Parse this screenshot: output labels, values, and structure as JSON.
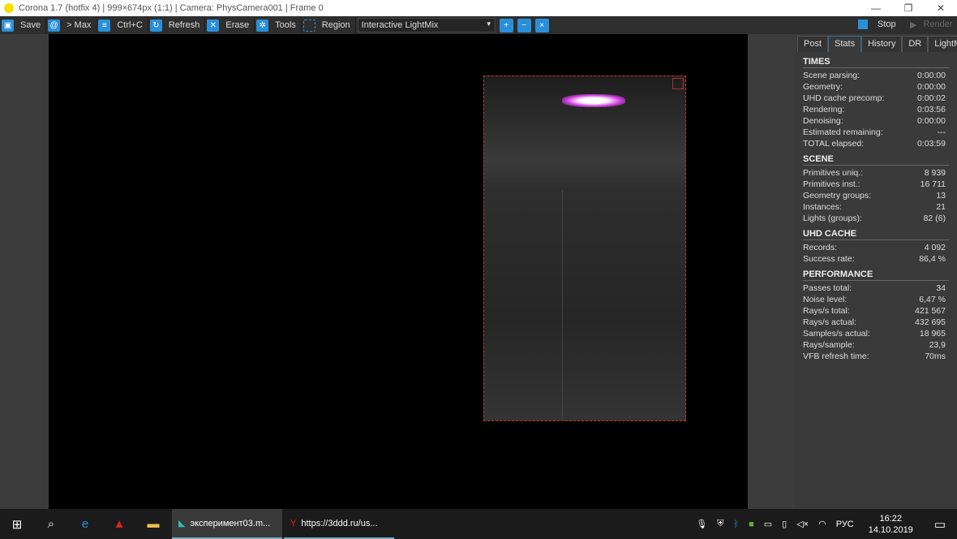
{
  "window": {
    "title": "Corona 1.7 (hotfix 4) | 999×674px (1:1) | Camera: PhysCamera001 | Frame 0",
    "minimize": "—",
    "restore": "❐",
    "close": "✕"
  },
  "toolbar": {
    "save": "Save",
    "max": "> Max",
    "copy": "Ctrl+C",
    "refresh": "Refresh",
    "erase": "Erase",
    "tools": "Tools",
    "region": "Region",
    "mode": "Interactive LightMix",
    "stop": "Stop",
    "render": "Render"
  },
  "tabs": [
    "Post",
    "Stats",
    "History",
    "DR",
    "LightMix"
  ],
  "stats": {
    "times": {
      "title": "TIMES",
      "rows": [
        [
          "Scene parsing:",
          "0:00:00"
        ],
        [
          "Geometry:",
          "0:00:00"
        ],
        [
          "UHD cache precomp:",
          "0:00:02"
        ],
        [
          "Rendering:",
          "0:03:56"
        ],
        [
          "Denoising:",
          "0:00:00"
        ],
        [
          "Estimated remaining:",
          "---"
        ],
        [
          "TOTAL elapsed:",
          "0:03:59"
        ]
      ]
    },
    "scene": {
      "title": "SCENE",
      "rows": [
        [
          "Primitives uniq.:",
          "8 939"
        ],
        [
          "Primitives inst.:",
          "16 711"
        ],
        [
          "Geometry groups:",
          "13"
        ],
        [
          "Instances:",
          "21"
        ],
        [
          "Lights (groups):",
          "82 (6)"
        ]
      ]
    },
    "uhd": {
      "title": "UHD CACHE",
      "rows": [
        [
          "Records:",
          "4 092"
        ],
        [
          "Success rate:",
          "86,4 %"
        ]
      ]
    },
    "perf": {
      "title": "PERFORMANCE",
      "rows": [
        [
          "Passes total:",
          "34"
        ],
        [
          "Noise level:",
          "6,47 %"
        ],
        [
          "Rays/s total:",
          "421 567"
        ],
        [
          "Rays/s actual:",
          "432 695"
        ],
        [
          "Samples/s actual:",
          "18 965"
        ],
        [
          "Rays/sample:",
          "23,9"
        ],
        [
          "VFB refresh time:",
          "70ms"
        ]
      ]
    }
  },
  "taskbar": {
    "task1": "эксперимент03.m...",
    "task2": "https://3ddd.ru/us...",
    "lang": "РУС",
    "time": "16:22",
    "date": "14.10.2019"
  }
}
